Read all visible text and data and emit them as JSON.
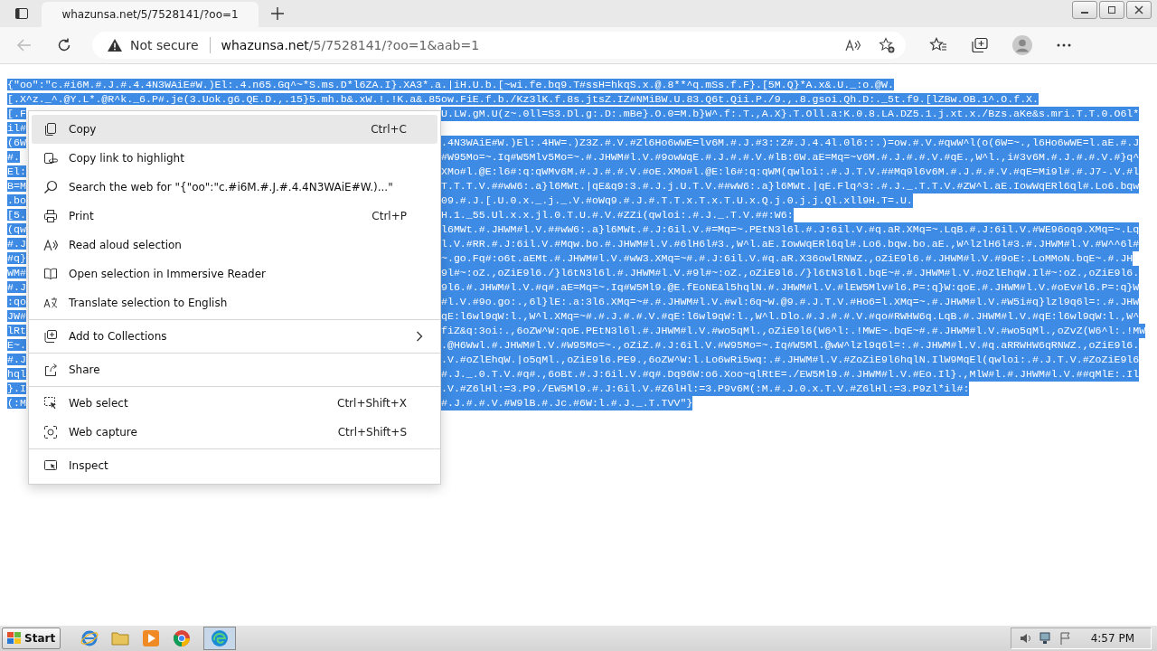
{
  "browser": {
    "tab": {
      "title": "whazunsa.net/5/7528141/?oo=1"
    },
    "address": {
      "security": "Not secure",
      "host": "whazunsa.net",
      "path": "/5/7528141/?oo=1&aab=1"
    }
  },
  "page": {
    "lines": [
      {
        "left": "{\"oo\":\"c.#i6M.#.J.#.4.4N3WAiE#W.)El:.4.n65.Gq^~*S.ms.D*l6ZA.I}.XA3*.a.|iH.U.b.[~wi.fe.bq9.T#ssH=hkqS.x.@.8**^q.mSs.f.F}.[5M.Q}*A.x&.U._:o.@W."
      },
      {
        "left": "[.X^z._^.@Y.L*.@R^k._6.P#.je(3.Uok.g6.QE.D.,.15}5.mh.b&.xW.!.!K.a&.85ow.FiE.f.b./Kz3lK.f.8s.jtsZ.IZ#NMiBW.U.83.Q6t.Qii.P./9.,.8.gsoi.Qh.D:._5t.f9.[lZBw.OB.1^.O.f.X."
      },
      {
        "left": "[.F",
        "right": "U.LW.gM.U(z~.0ll=S3.Dl.g:.D:.mBe}.O.0=M.b}W^.f:.T.,A.X}.T.Oll.a:K.0.8.LA.DZ5.1.j.xt.x./Bzs.aKe&s.mri.T.T.0.O6l*"
      },
      {
        "left": "il#"
      },
      {
        "left": "(6W",
        "right": ".4N3WAiE#W.)El:.4HW=.)Z3Z.#.V.#Zl6Ho6wWE=lv6M.#.J.#3::Z#.J.4.4l.0l6::.)=ow.#.V.#qwW^l(o(6W=~.,l6Ho6wWE=l.aE.#.J"
      },
      {
        "left": "#.",
        "right": "#W95Mo=~.Iq#W5Mlv5Mo=~.#.JHWM#l.V.#9owWqE.#.J.#.#.V.#lB:6W.aE=Mq=~v6M.#.J.#.#.V.#qE.,W^l.,i#3v6M.#.J.#.#.V.#}q^"
      },
      {
        "left": "El:",
        "right": "XMo#l.@E:l6#:q:qWMv6M.#.J.#.#.V.#oE.XMo#l.@E:l6#:q:qWM(qwloi:.#.J.T.V.##Mq9l6v6M.#.J.#.#.V.#qE=Mi9l#.#.J7-.V.#l"
      },
      {
        "left": "B=M",
        "right": "T.T.T.V.##wW6:.a}l6MWt.|qE&q9:3.#.J.j.U.T.V.##wW6:.a}l6MWt.|qE.Flq^3:.#.J._.T.T.V.#ZW^l.aE.IowWqERl6ql#.Lo6.bqw"
      },
      {
        "left": ".bo",
        "right": "09.#.J.[.U.0.x._.j._.V.#oWq9.#.J.#.T.T.x.T.x.T.U.x.Q.j.0.j.j.Ql.xll9H.T=.U."
      },
      {
        "left": "[5.",
        "right": "H.1._55.Ul.x.x.jl.0.T.U.#.V.#ZZi(qwloi:.#.J._.T.V.##:W6:"
      },
      {
        "left": "(qw",
        "right": "l6MWt.#.JHWM#l.V.##wW6:.a}l6MWt.#.J:6il.V.#=Mq=~.PEtN3l6l.#.J:6il.V.#q.aR.XMq=~.LqB.#.J:6il.V.#WE96oq9.XMq=~.Lq"
      },
      {
        "left": "#.J",
        "right": "l.V.#RR.#.J:6il.V.#Mqw.bo.#.JHWM#l.V.#6lH6l#3.,W^l.aE.IowWqERl6ql#.Lo6.bqw.bo.aE.,W^lzlH6l#3.#.JHWM#l.V.#W^^6l#"
      },
      {
        "left": "#q}",
        "right": "~.go.Fq#:o6t.aEMt.#.JHWM#l.V.#wW3.XMq=~#.#.J:6il.V.#q.aR.X36owlRNWZ.,oZiE9l6.#.JHWM#l.V.#9oE:.LoMMoN.bqE~.#.JH"
      },
      {
        "left": "WM#",
        "right": "9l#~:oZ.,oZiE9l6./}l6tN3l6l.#.JHWM#l.V.#9l#~:oZ.,oZiE9l6./}l6tN3l6l.bqE~#.#.JHWM#l.V.#oZlEhqW.Il#~:oZ.,oZiE9l6."
      },
      {
        "left": "#.J",
        "right": "9l6.#.JHWM#l.V.#q#.aE=Mq=~.Iq#W5Ml9.@E.fEoNE&l5hqlN.#.JHWM#l.V.#lEW5Mlv#l6.P=:q}W:qoE.#.JHWM#l.V.#oEv#l6.P=:q}W"
      },
      {
        "left": ":qo",
        "right": "#l.V.#9o.go:.,6l}lE:.a:3l6.XMq=~#.#.JHWM#l.V.#wl:6q~W.@9.#.J.T.V.#Ho6=l.XMq=~.#.JHWM#l.V.#W5i#q}lzl9q6l=:.#.JHW"
      },
      {
        "left": "JW#",
        "right": "qE:l6wl9qW:l.,W^l.XMq=~#.#.J.#.#.V.#qE:l6wl9qW:l.,W^l.Dlo.#.J.#.#.V.#qo#RWHW6q.LqB.#.JHWM#l.V.#qE:l6wl9qW:l.,W^"
      },
      {
        "left": "lRt",
        "right": "fiZ&q:3oi:.,6oZW^W:qoE.PEtN3l6l.#.JHWM#l.V.#wo5qMl.,oZiE9l6(W6^l:.!MWE~.bqE~#.#.JHWM#l.V.#wo5qMl.,oZvZ(W6^l:.!MW"
      },
      {
        "left": "E~.",
        "right": ".@H6Wwl.#.JHWM#l.V.#W95Mo=~.,oZiZ.#.J:6il.V.#W95Mo=~.Iq#W5Ml.@wW^lzl9q6l=:.#.JHWM#l.V.#q.aRRWHW6qRNWZ.,oZiE9l6."
      },
      {
        "left": "#.J",
        "right": ".V.#oZlEhqW.|o5qMl.,oZiE9l6.PE9.,6oZW^W:l.Lo6wRi5wq:.#.JHWM#l.V.#ZoZiE9l6hqlN.IlW9MqEl(qwloi:.#.J.T.V.#ZoZiE9l6"
      },
      {
        "left": "hql",
        "right": "#.J._.0.T.V.#q#.,6oBt.#.J:6il.V.#q#.Dq96W:o6.Xoo~qlRtE=./EW5Ml9.#.JHWM#l.V.#Eo.Il}.,MlW#l.#.JHWM#l.V.##qMlE:.Il"
      },
      {
        "left": "}.I",
        "right": ".V.#Z6lHl:=3.P9./EW5Ml9.#.J:6il.V.#Z6lHl:=3.P9v6M(:M.#.J.0.x.T.V.#Z6lHl:=3.P9zl*il#:"
      },
      {
        "left": "(:M",
        "right": "#.J.#.#.V.#W9lB.#.Jc.#6W:l.#.J._.T.TVV\"}"
      }
    ]
  },
  "context_menu": {
    "items": [
      {
        "kind": "item",
        "label": "Copy",
        "shortcut": "Ctrl+C",
        "selected": true
      },
      {
        "kind": "item",
        "label": "Copy link to highlight",
        "selected": false
      },
      {
        "kind": "item",
        "label": "Search the web for \"{\"oo\":\"c.#i6M.#.J.#.4.4N3WAiE#W.)...\"",
        "selected": false
      },
      {
        "kind": "item",
        "label": "Print",
        "shortcut": "Ctrl+P",
        "selected": false
      },
      {
        "kind": "item",
        "label": "Read aloud selection",
        "selected": false
      },
      {
        "kind": "item",
        "label": "Open selection in Immersive Reader",
        "selected": false
      },
      {
        "kind": "item",
        "label": "Translate selection to English",
        "selected": false
      },
      {
        "kind": "separator"
      },
      {
        "kind": "submenu",
        "label": "Add to Collections",
        "selected": false
      },
      {
        "kind": "separator"
      },
      {
        "kind": "item",
        "label": "Share",
        "selected": false
      },
      {
        "kind": "separator"
      },
      {
        "kind": "item",
        "label": "Web select",
        "shortcut": "Ctrl+Shift+X",
        "selected": false
      },
      {
        "kind": "item",
        "label": "Web capture",
        "shortcut": "Ctrl+Shift+S",
        "selected": false
      },
      {
        "kind": "separator"
      },
      {
        "kind": "item",
        "label": "Inspect",
        "selected": false
      }
    ]
  },
  "taskbar": {
    "start": "Start",
    "clock": "4:57 PM"
  }
}
